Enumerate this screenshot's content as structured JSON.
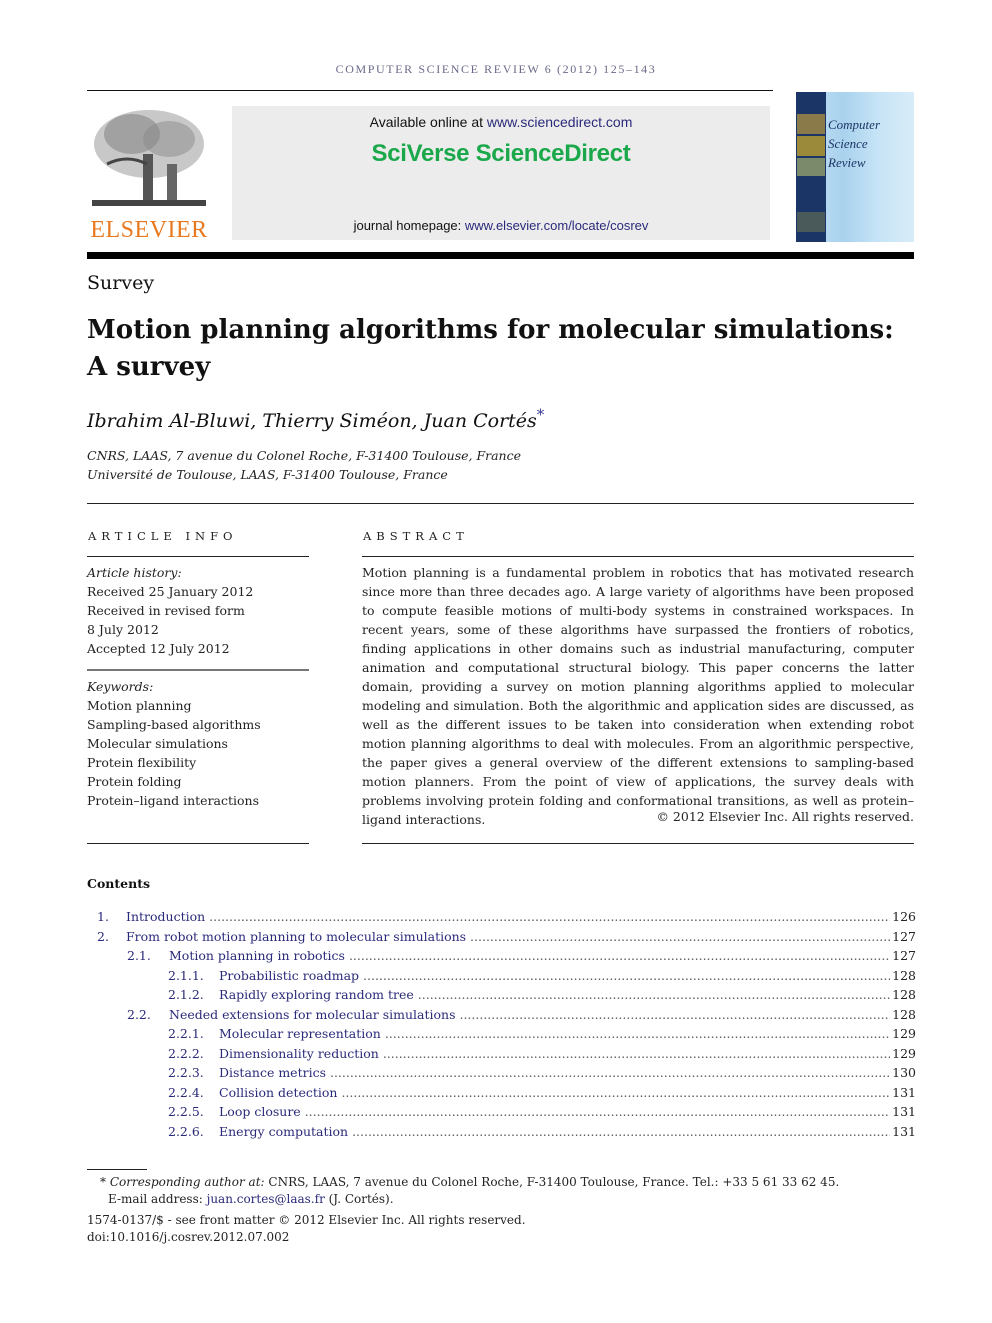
{
  "header": {
    "running_head": "COMPUTER SCIENCE REVIEW 6 (2012) 125–143",
    "publisher_logo": "ELSEVIER",
    "available_online_prefix": "Available online at ",
    "available_online_link": "www.sciencedirect.com",
    "brand": "SciVerse ScienceDirect",
    "homepage_prefix": "journal homepage: ",
    "homepage_link": "www.elsevier.com/locate/cosrev",
    "cover_title": [
      "Computer",
      "Science",
      "Review"
    ]
  },
  "article": {
    "type": "Survey",
    "title_line1": "Motion planning algorithms for molecular simulations:",
    "title_line2": "A survey",
    "authors": "Ibrahim Al-Bluwi, Thierry Siméon, Juan Cortés",
    "corresponding_mark": "*",
    "affiliations": [
      "CNRS, LAAS, 7 avenue du Colonel Roche, F-31400 Toulouse, France",
      "Université de Toulouse, LAAS, F-31400 Toulouse, France"
    ]
  },
  "article_info": {
    "heading": "ARTICLE INFO",
    "history_label": "Article history:",
    "history": [
      "Received 25 January 2012",
      "Received in revised form",
      "8 July 2012",
      "Accepted 12 July 2012"
    ],
    "keywords_label": "Keywords:",
    "keywords": [
      "Motion planning",
      "Sampling-based algorithms",
      "Molecular simulations",
      "Protein flexibility",
      "Protein folding",
      "Protein–ligand interactions"
    ]
  },
  "abstract": {
    "heading": "ABSTRACT",
    "text": "Motion planning is a fundamental problem in robotics that has motivated research since more than three decades ago. A large variety of algorithms have been proposed to compute feasible motions of multi-body systems in constrained workspaces. In recent years, some of these algorithms have surpassed the frontiers of robotics, finding applications in other domains such as industrial manufacturing, computer animation and computational structural biology. This paper concerns the latter domain, providing a survey on motion planning algorithms applied to molecular modeling and simulation. Both the algorithmic and application sides are discussed, as well as the different issues to be taken into consideration when extending robot motion planning algorithms to deal with molecules. From an algorithmic perspective, the paper gives a general overview of the different extensions to sampling-based motion planners. From the point of view of applications, the survey deals with problems involving protein folding and conformational transitions, as well as protein–ligand interactions.",
    "copyright": "© 2012 Elsevier Inc. All rights reserved."
  },
  "contents": {
    "heading": "Contents",
    "items": [
      {
        "num": "1.",
        "title": "Introduction",
        "page": "126",
        "level": 1
      },
      {
        "num": "2.",
        "title": "From robot motion planning to molecular simulations",
        "page": "127",
        "level": 1
      },
      {
        "num": "2.1.",
        "title": "Motion planning in robotics",
        "page": "127",
        "level": 2
      },
      {
        "num": "2.1.1.",
        "title": "Probabilistic roadmap",
        "page": "128",
        "level": 3
      },
      {
        "num": "2.1.2.",
        "title": "Rapidly exploring random tree",
        "page": "128",
        "level": 3
      },
      {
        "num": "2.2.",
        "title": "Needed extensions for molecular simulations",
        "page": "128",
        "level": 2
      },
      {
        "num": "2.2.1.",
        "title": "Molecular representation",
        "page": "129",
        "level": 3
      },
      {
        "num": "2.2.2.",
        "title": "Dimensionality reduction",
        "page": "129",
        "level": 3
      },
      {
        "num": "2.2.3.",
        "title": "Distance metrics",
        "page": "130",
        "level": 3
      },
      {
        "num": "2.2.4.",
        "title": "Collision detection",
        "page": "131",
        "level": 3
      },
      {
        "num": "2.2.5.",
        "title": "Loop closure",
        "page": "131",
        "level": 3
      },
      {
        "num": "2.2.6.",
        "title": "Energy computation",
        "page": "131",
        "level": 3
      }
    ]
  },
  "footnotes": {
    "mark": "*",
    "corresponding_label": "Corresponding author at:",
    "corresponding_text": " CNRS, LAAS, 7 avenue du Colonel Roche, F-31400 Toulouse, France. Tel.: +33 5 61 33 62 45.",
    "email_label": "E-mail address: ",
    "email": "juan.cortes@laas.fr",
    "email_suffix": " (J. Cortés).",
    "issn_line": "1574-0137/$ - see front matter © 2012 Elsevier Inc. All rights reserved.",
    "doi": "doi:10.1016/j.cosrev.2012.07.002"
  }
}
